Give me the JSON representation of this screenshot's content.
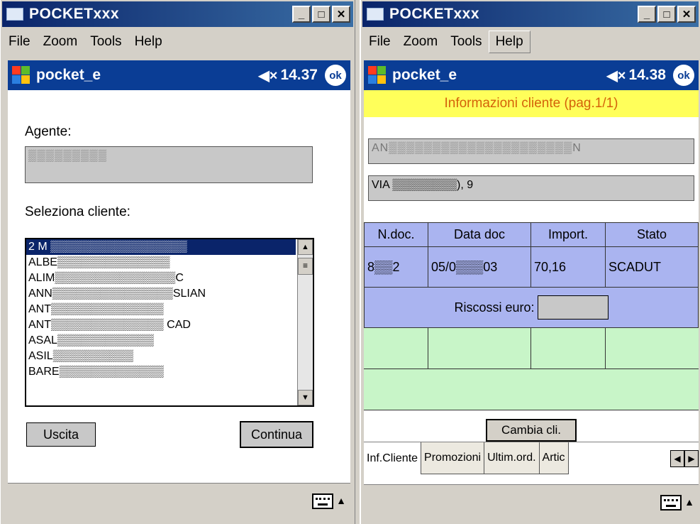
{
  "left": {
    "title": "POCKETxxx",
    "menu": [
      "File",
      "Zoom",
      "Tools",
      "Help"
    ],
    "pda_title": "pocket_e",
    "time": "14.37",
    "ok": "ok",
    "agent_label": "Agente:",
    "agent_value": "▒▒▒▒▒▒▒▒▒",
    "select_label": "Seleziona cliente:",
    "clients": [
      "2 M ▒▒▒▒▒▒▒▒▒▒▒▒▒▒▒▒▒",
      "ALBE▒▒▒▒▒▒▒▒▒▒▒▒▒▒",
      "ALIM▒▒▒▒▒▒▒▒▒▒▒▒▒▒▒C",
      "ANN▒▒▒▒▒▒▒▒▒▒▒▒▒▒▒SLIAN",
      "ANT▒▒▒▒▒▒▒▒▒▒▒▒▒▒",
      "ANT▒▒▒▒▒▒▒▒▒▒▒▒▒▒ CAD",
      "ASAL▒▒▒▒▒▒▒▒▒▒▒▒",
      "ASIL▒▒▒▒▒▒▒▒▒▒",
      "BARE▒▒▒▒▒▒▒▒▒▒▒▒▒"
    ],
    "exit_button": "Uscita",
    "continue_button": "Continua"
  },
  "right": {
    "title": "POCKETxxx",
    "menu": [
      "File",
      "Zoom",
      "Tools",
      "Help"
    ],
    "pda_title": "pocket_e",
    "time": "14.38",
    "ok": "ok",
    "info_header": "Informazioni cliente (pag.1/1)",
    "client_name": "AN▒▒▒▒▒▒▒▒▒▒▒▒▒▒▒▒▒▒▒▒▒N",
    "client_address": "VIA ▒▒▒▒▒▒▒▒), 9",
    "table_headers": [
      "N.doc.",
      "Data doc",
      "Import.",
      "Stato"
    ],
    "table_row": [
      "8▒▒2",
      "05/0▒▒▒03",
      "70,16",
      "SCADUT"
    ],
    "riscossi_label": "Riscossi euro:",
    "change_button": "Cambia cli.",
    "tabs": [
      "Inf.Cliente",
      "Promozioni",
      "Ultim.ord.",
      "Artic"
    ]
  },
  "colors": {
    "titlebar": "#0a246a",
    "pda_bar": "#0a3d95",
    "info_header_bg": "#ffff5a",
    "info_header_text": "#d4620a",
    "table_blue": "#aab4f0",
    "table_green": "#c8f5c8"
  }
}
